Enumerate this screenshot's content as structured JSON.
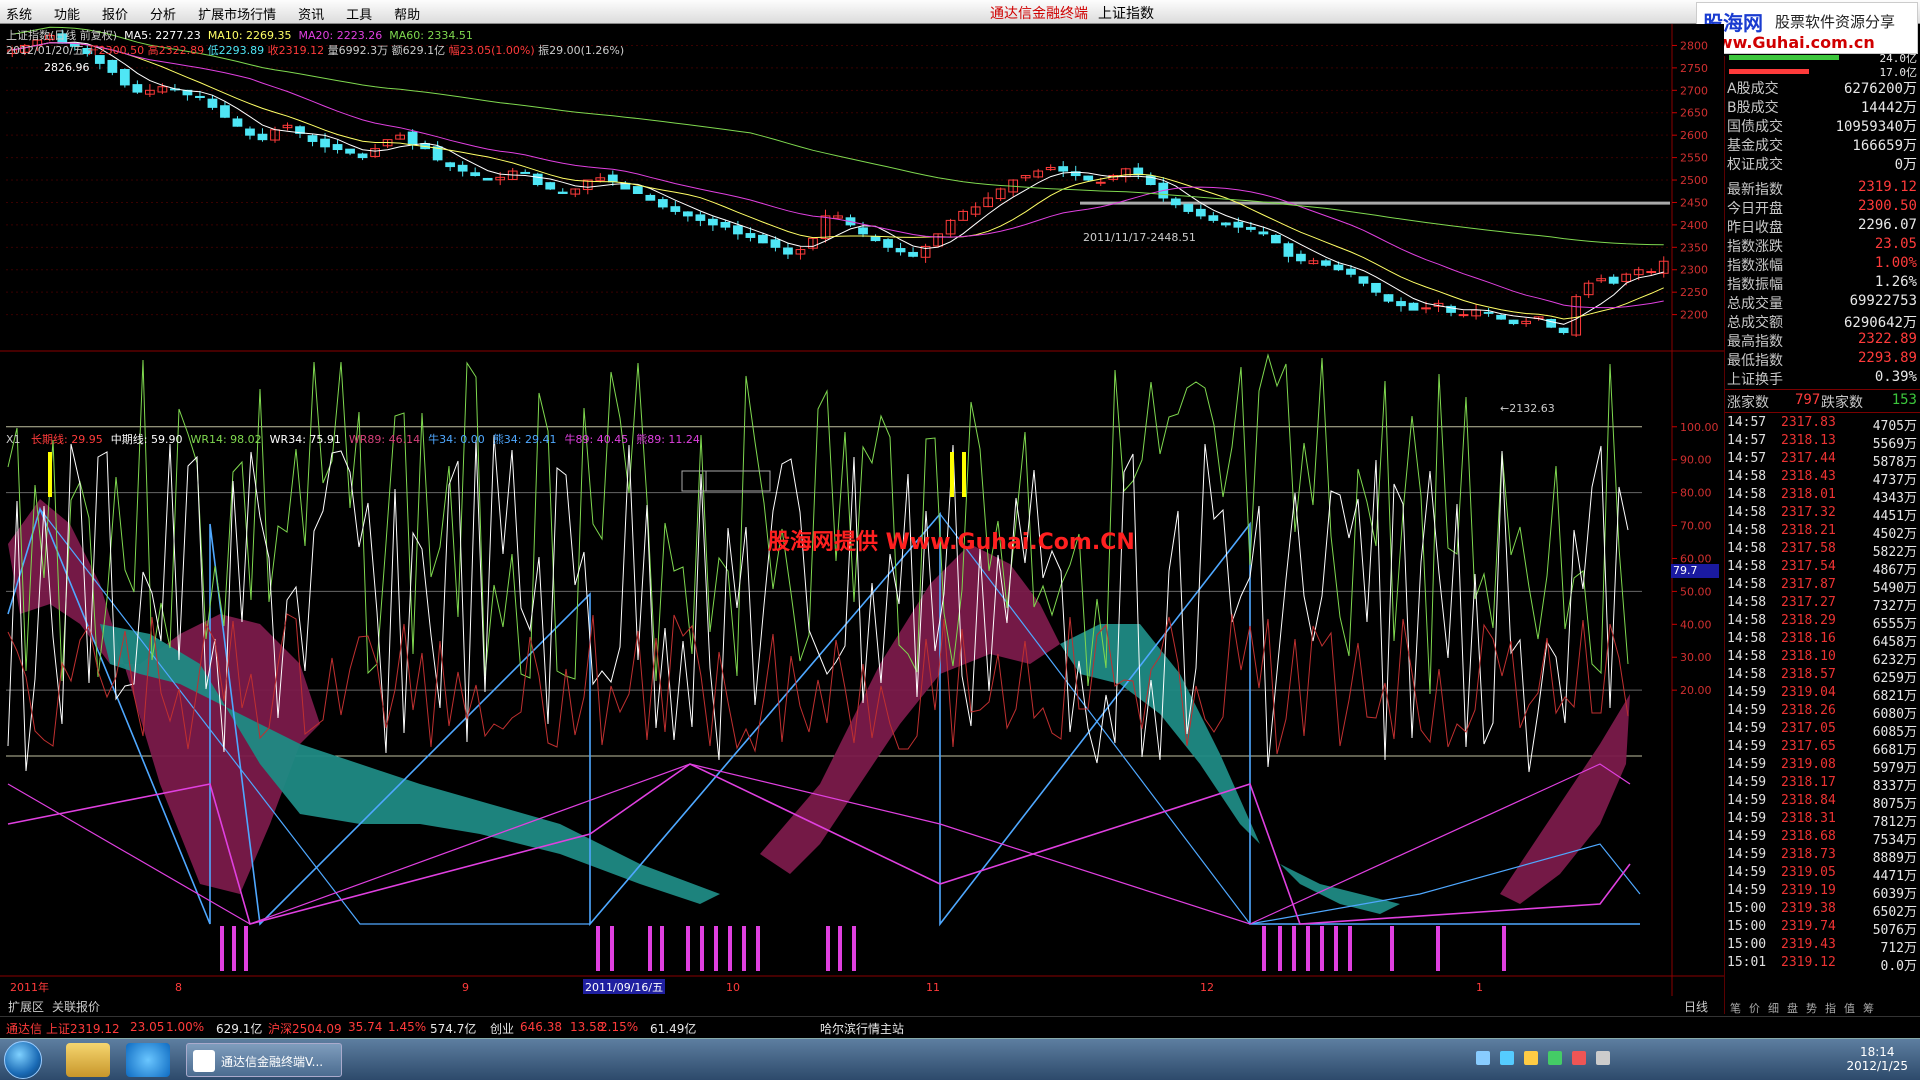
{
  "menu": [
    "系统",
    "功能",
    "报价",
    "分析",
    "扩展市场行情",
    "资讯",
    "工具",
    "帮助"
  ],
  "app_title": "通达信金融终端",
  "app_subtitle": "上证指数",
  "brand": {
    "line1": "股海网",
    "line2": "股票软件资源分享",
    "line3": "www.Guhai.com.cn"
  },
  "chart_info": {
    "line1_name": "上证指数(日线 前复权)",
    "ma5": "MA5: 2277.23",
    "ma10": "MA10: 2269.35",
    "ma20": "MA20: 2223.26",
    "ma60": "MA60: 2334.51",
    "line2_date": "2012/01/20/五",
    "open": "开2300.50",
    "high": "高2322.89",
    "low": "低2293.89",
    "close": "收2319.12",
    "vol": "量6992.3万",
    "amount": "额629.1亿",
    "change": "幅23.05(1.00%)",
    "swing": "振29.00(1.26%)"
  },
  "chart_annotations": {
    "high_label": "2826.96",
    "mid_label": "2011/11/17-2448.51",
    "low_label": "←2132.63",
    "watermark": "股海网提供 Www.Guhai.Com.CN",
    "cursor_value": "79.7"
  },
  "indicator_info": {
    "title": "X1",
    "items": [
      {
        "text": "长期线: 29.95",
        "color": "#ff3b3b"
      },
      {
        "text": "中期线: 59.90",
        "color": "#ffffff"
      },
      {
        "text": "WR14: 98.02",
        "color": "#7fd84f"
      },
      {
        "text": "WR34: 75.91",
        "color": "#ffffff"
      },
      {
        "text": "WR89: 46.14",
        "color": "#d6407a"
      },
      {
        "text": "牛34: 0.00",
        "color": "#4fa8ff"
      },
      {
        "text": "熊34: 29.41",
        "color": "#4fa8ff"
      },
      {
        "text": "牛89: 40.45",
        "color": "#e040e0"
      },
      {
        "text": "熊89: 11.24",
        "color": "#e040e0"
      }
    ]
  },
  "chart_data": [
    {
      "type": "candlestick",
      "title": "上证指数(日线 前复权)",
      "ylim": [
        2130,
        2830
      ],
      "y_ticks": [
        2200,
        2250,
        2300,
        2350,
        2400,
        2450,
        2500,
        2550,
        2600,
        2650,
        2700,
        2750,
        2800
      ],
      "x_labels": [
        "2011年",
        "8",
        "9",
        "2011/09/16/五",
        "10",
        "11",
        "12",
        "1"
      ],
      "series": [
        {
          "name": "MA5"
        },
        {
          "name": "MA10"
        },
        {
          "name": "MA20"
        },
        {
          "name": "MA60"
        }
      ],
      "closes": [
        2790,
        2800,
        2812,
        2822,
        2805,
        2798,
        2782,
        2760,
        2740,
        2712,
        2696,
        2700,
        2708,
        2702,
        2690,
        2684,
        2662,
        2640,
        2620,
        2600,
        2590,
        2612,
        2622,
        2604,
        2586,
        2574,
        2568,
        2560,
        2550,
        2570,
        2590,
        2600,
        2580,
        2570,
        2545,
        2530,
        2520,
        2510,
        2500,
        2506,
        2520,
        2515,
        2490,
        2480,
        2470,
        2480,
        2500,
        2505,
        2496,
        2480,
        2470,
        2455,
        2440,
        2430,
        2420,
        2410,
        2400,
        2395,
        2380,
        2372,
        2360,
        2350,
        2335,
        2345,
        2370,
        2420,
        2420,
        2400,
        2380,
        2365,
        2350,
        2340,
        2330,
        2352,
        2380,
        2410,
        2430,
        2440,
        2460,
        2480,
        2500,
        2510,
        2520,
        2528,
        2520,
        2510,
        2500,
        2495,
        2510,
        2525,
        2512,
        2490,
        2460,
        2445,
        2430,
        2420,
        2410,
        2400,
        2395,
        2390,
        2380,
        2360,
        2330,
        2320,
        2320,
        2310,
        2300,
        2290,
        2270,
        2250,
        2230,
        2220,
        2210,
        2215,
        2225,
        2205,
        2200,
        2210,
        2205,
        2190,
        2180,
        2185,
        2195,
        2172,
        2160,
        2240,
        2270,
        2280,
        2270,
        2290,
        2300,
        2296,
        2319
      ],
      "last": {
        "open": 2300.5,
        "high": 2322.89,
        "low": 2293.89,
        "close": 2319.12
      }
    },
    {
      "type": "line",
      "title": "X1",
      "ylim": [
        0,
        100
      ],
      "y_ticks": [
        20,
        30,
        40,
        50,
        60,
        70,
        80,
        90,
        100
      ],
      "series": [
        {
          "name": "长期线",
          "last": 29.95
        },
        {
          "name": "中期线",
          "last": 59.9
        },
        {
          "name": "WR14",
          "last": 98.02
        },
        {
          "name": "WR34",
          "last": 75.91
        },
        {
          "name": "WR89",
          "last": 46.14
        },
        {
          "name": "牛34",
          "last": 0.0
        },
        {
          "name": "熊34",
          "last": 29.41
        },
        {
          "name": "牛89",
          "last": 40.45
        },
        {
          "name": "熊89",
          "last": 11.24
        }
      ]
    }
  ],
  "panel": {
    "volume_rows": [
      {
        "label": "A股成交",
        "value": "6276200万",
        "color": "#e8e8e8"
      },
      {
        "label": "B股成交",
        "value": "14442万",
        "color": "#e8e8e8"
      },
      {
        "label": "国债成交",
        "value": "10959340万",
        "color": "#e8e8e8"
      },
      {
        "label": "基金成交",
        "value": "166659万",
        "color": "#e8e8e8"
      },
      {
        "label": "权证成交",
        "value": "0万",
        "color": "#e8e8e8"
      }
    ],
    "top_values": [
      "24.0亿",
      "17.0亿"
    ],
    "quote_rows": [
      {
        "label": "最新指数",
        "value": "2319.12",
        "color": "#ff3b3b"
      },
      {
        "label": "今日开盘",
        "value": "2300.50",
        "color": "#ff3b3b"
      },
      {
        "label": "昨日收盘",
        "value": "2296.07",
        "color": "#e8e8e8"
      },
      {
        "label": "指数涨跌",
        "value": "23.05",
        "color": "#ff3b3b"
      },
      {
        "label": "指数涨幅",
        "value": "1.00%",
        "color": "#ff3b3b"
      },
      {
        "label": "指数振幅",
        "value": "1.26%",
        "color": "#e8e8e8"
      },
      {
        "label": "总成交量",
        "value": "69922753",
        "color": "#e8e8e8"
      },
      {
        "label": "总成交额",
        "value": "6290642万",
        "color": "#e8e8e8"
      },
      {
        "label": "最高指数",
        "value": "2322.89",
        "color": "#ff3b3b"
      },
      {
        "label": "最低指数",
        "value": "2293.89",
        "color": "#ff3b3b"
      },
      {
        "label": "上证换手",
        "value": "0.39%",
        "color": "#e8e8e8"
      }
    ],
    "up_label": "涨家数",
    "up_value": "797",
    "down_label": "跌家数",
    "down_value": "153",
    "ticks": [
      [
        "14:57",
        "2317.83",
        "4705万"
      ],
      [
        "14:57",
        "2318.13",
        "5569万"
      ],
      [
        "14:57",
        "2317.44",
        "5878万"
      ],
      [
        "14:58",
        "2318.43",
        "4737万"
      ],
      [
        "14:58",
        "2318.01",
        "4343万"
      ],
      [
        "14:58",
        "2317.32",
        "4451万"
      ],
      [
        "14:58",
        "2318.21",
        "4502万"
      ],
      [
        "14:58",
        "2317.58",
        "5822万"
      ],
      [
        "14:58",
        "2317.54",
        "4867万"
      ],
      [
        "14:58",
        "2317.87",
        "5490万"
      ],
      [
        "14:58",
        "2317.27",
        "7327万"
      ],
      [
        "14:58",
        "2318.29",
        "6555万"
      ],
      [
        "14:58",
        "2318.16",
        "6458万"
      ],
      [
        "14:58",
        "2318.10",
        "6232万"
      ],
      [
        "14:58",
        "2318.57",
        "6259万"
      ],
      [
        "14:59",
        "2319.04",
        "6821万"
      ],
      [
        "14:59",
        "2318.26",
        "6080万"
      ],
      [
        "14:59",
        "2317.05",
        "6085万"
      ],
      [
        "14:59",
        "2317.65",
        "6681万"
      ],
      [
        "14:59",
        "2319.08",
        "5979万"
      ],
      [
        "14:59",
        "2318.17",
        "8337万"
      ],
      [
        "14:59",
        "2318.84",
        "8075万"
      ],
      [
        "14:59",
        "2318.31",
        "7812万"
      ],
      [
        "14:59",
        "2318.68",
        "7534万"
      ],
      [
        "14:59",
        "2318.73",
        "8889万"
      ],
      [
        "14:59",
        "2319.05",
        "4471万"
      ],
      [
        "14:59",
        "2319.19",
        "6039万"
      ],
      [
        "15:00",
        "2319.38",
        "6502万"
      ],
      [
        "15:00",
        "2319.74",
        "5076万"
      ],
      [
        "15:00",
        "2319.43",
        "712万"
      ],
      [
        "15:01",
        "2319.12",
        "0.0万"
      ]
    ],
    "tabs": [
      "笔",
      "价",
      "细",
      "盘",
      "势",
      "指",
      "值",
      "筹"
    ]
  },
  "tabbar": {
    "left": "扩展区",
    "center": "关联报价",
    "right": "日线"
  },
  "ticker": [
    {
      "text": "通达信",
      "color": "#ff3b3b"
    },
    {
      "text": "上证2319.12",
      "color": "#ff3b3b"
    },
    {
      "text": "23.05",
      "color": "#ff3b3b"
    },
    {
      "text": "1.00%",
      "color": "#ff3b3b"
    },
    {
      "text": "629.1亿",
      "color": "#e8e8e8"
    },
    {
      "text": "沪深2504.09",
      "color": "#ff3b3b"
    },
    {
      "text": "35.74",
      "color": "#ff3b3b"
    },
    {
      "text": "1.45%",
      "color": "#ff3b3b"
    },
    {
      "text": "574.7亿",
      "color": "#e8e8e8"
    },
    {
      "text": "创业",
      "color": "#e8e8e8"
    },
    {
      "text": "646.38",
      "color": "#ff3b3b"
    },
    {
      "text": "13.58",
      "color": "#ff3b3b"
    },
    {
      "text": "2.15%",
      "color": "#ff3b3b"
    },
    {
      "text": "61.49亿",
      "color": "#e8e8e8"
    },
    {
      "text": "哈尔滨行情主站",
      "color": "#e8e8e8"
    }
  ],
  "taskbar": {
    "task_label": "通达信金融终端V...",
    "time": "18:14",
    "date": "2012/1/25"
  },
  "colors": {
    "up": "#ff3b3b",
    "down": "#4fe6f5",
    "ma5": "#ffffff",
    "ma10": "#ffff66",
    "ma20": "#e040e0",
    "ma60": "#7fd84f"
  }
}
